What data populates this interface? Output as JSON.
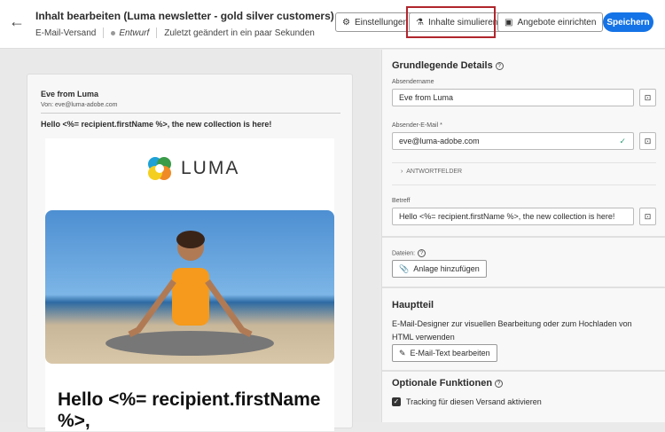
{
  "header": {
    "title": "Inhalt bearbeiten (Luma newsletter - gold silver customers)",
    "channel": "E-Mail-Versand",
    "status": "Entwurf",
    "modified": "Zuletzt geändert in ein paar Sekunden",
    "buttons": {
      "settings": "Einstellungen",
      "simulate": "Inhalte simulieren",
      "offers": "Angebote einrichten",
      "save": "Speichern"
    }
  },
  "preview": {
    "sender_name": "Eve from Luma",
    "from_line": "Von: eve@luma-adobe.com",
    "subject": "Hello <%= recipient.firstName %>, the new collection is here!",
    "logo": "LUMA",
    "headline": "Hello <%= recipient.firstName %>,"
  },
  "details": {
    "title": "Grundlegende Details",
    "sender_name_label": "Absendername",
    "sender_name_value": "Eve from Luma",
    "sender_email_label": "Absender-E-Mail *",
    "sender_email_value": "eve@luma-adobe.com",
    "reply_fields": "ANTWORTFELDER",
    "subject_label": "Betreff",
    "subject_value": "Hello <%= recipient.firstName %>, the new collection is here!",
    "files_label": "Dateien:",
    "add_attachment": "Anlage hinzufügen"
  },
  "body": {
    "title": "Hauptteil",
    "description": "E-Mail-Designer zur visuellen Bearbeitung oder zum Hochladen von HTML verwenden",
    "edit_button": "E-Mail-Text bearbeiten"
  },
  "optional": {
    "title": "Optionale Funktionen",
    "tracking": "Tracking für diesen Versand aktivieren",
    "tracking_checked": true
  },
  "colors": {
    "accent": "#1473e6",
    "highlight": "#b0262c"
  }
}
